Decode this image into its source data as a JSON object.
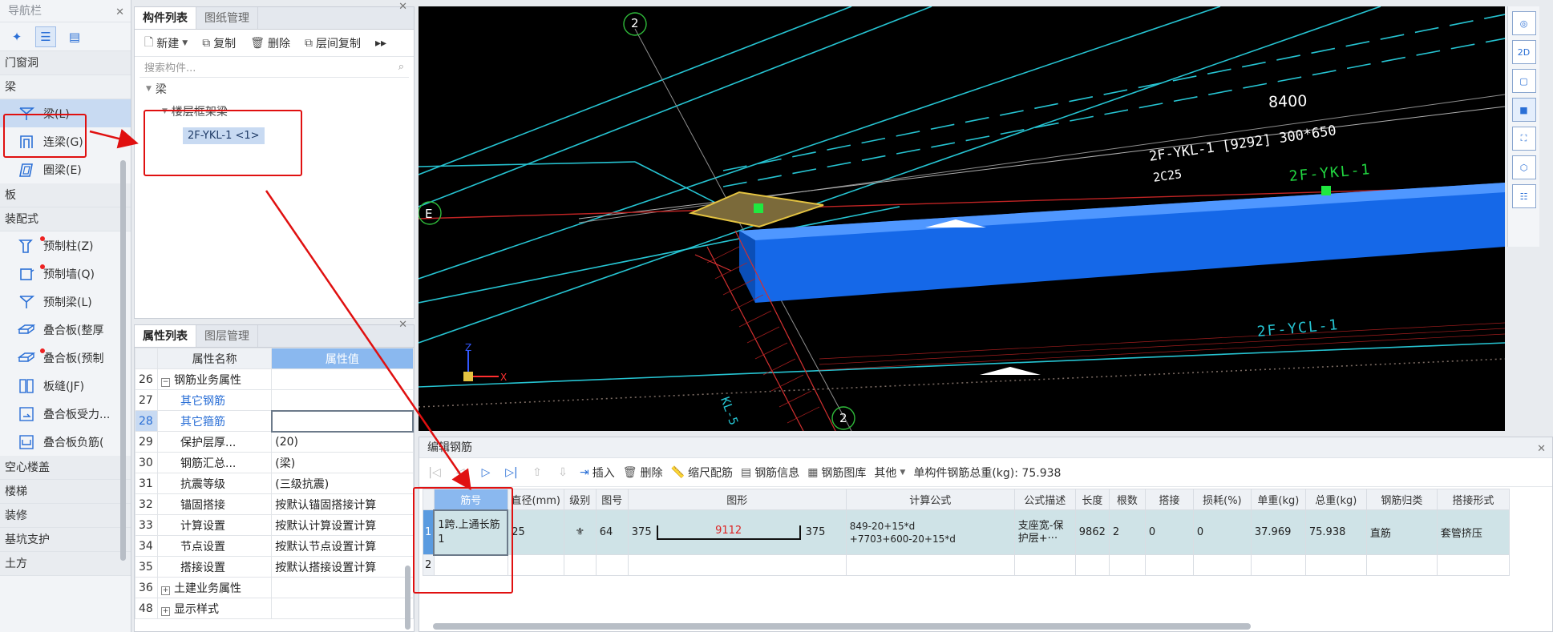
{
  "nav": {
    "title": "导航栏",
    "categories": {
      "door_window": "门窗洞",
      "beam_cat": "梁",
      "slab": "板",
      "prefab": "装配式",
      "hollow": "空心楼盖",
      "stairs": "楼梯",
      "decoration": "装修",
      "foundation_support": "基坑支护",
      "earthwork": "土方"
    },
    "beam_items": [
      "梁(L)",
      "连梁(G)",
      "圈梁(E)"
    ],
    "prefab_items": [
      "预制柱(Z)",
      "预制墙(Q)",
      "预制梁(L)",
      "叠合板(整厚",
      "叠合板(预制",
      "板缝(JF)",
      "叠合板受力...",
      "叠合板负筋("
    ]
  },
  "component_panel": {
    "tabs": [
      "构件列表",
      "图纸管理"
    ],
    "toolbar": [
      "新建",
      "复制",
      "删除",
      "层间复制"
    ],
    "search_placeholder": "搜索构件...",
    "tree_root": "梁",
    "tree_group": "楼层框架梁",
    "tree_item": "2F-YKL-1 <1>"
  },
  "property_panel": {
    "tabs": [
      "属性列表",
      "图层管理"
    ],
    "headers": [
      "属性名称",
      "属性值"
    ],
    "rows": [
      {
        "n": "26",
        "name": "钢筋业务属性",
        "value": "",
        "kind": "group"
      },
      {
        "n": "27",
        "name": "其它钢筋",
        "value": "",
        "kind": "link"
      },
      {
        "n": "28",
        "name": "其它箍筋",
        "value": "",
        "kind": "link-edit"
      },
      {
        "n": "29",
        "name": "保护层厚...",
        "value": "(20)",
        "kind": "normal"
      },
      {
        "n": "30",
        "name": "钢筋汇总...",
        "value": "(梁)",
        "kind": "normal"
      },
      {
        "n": "31",
        "name": "抗震等级",
        "value": "(三级抗震)",
        "kind": "normal"
      },
      {
        "n": "32",
        "name": "锚固搭接",
        "value": "按默认锚固搭接计算",
        "kind": "normal"
      },
      {
        "n": "33",
        "name": "计算设置",
        "value": "按默认计算设置计算",
        "kind": "normal"
      },
      {
        "n": "34",
        "name": "节点设置",
        "value": "按默认节点设置计算",
        "kind": "normal"
      },
      {
        "n": "35",
        "name": "搭接设置",
        "value": "按默认搭接设置计算",
        "kind": "normal"
      },
      {
        "n": "36",
        "name": "土建业务属性",
        "value": "",
        "kind": "group"
      },
      {
        "n": "48",
        "name": "显示样式",
        "value": "",
        "kind": "group"
      }
    ]
  },
  "viewport": {
    "axis_top": "2",
    "axis_bottom": "2",
    "axis_left": "E",
    "dimension": "8400",
    "beam_label": "2F-YKL-1 [9292] 300*650",
    "beam_sub": "2C25",
    "beam_tag": "2F-YKL-1",
    "beam_tag2": "2F-YCL-1",
    "vert_tag": "KL-5"
  },
  "rebar_panel": {
    "title": "编辑钢筋",
    "toolbar": [
      "插入",
      "删除",
      "缩尺配筋",
      "钢筋信息",
      "钢筋图库",
      "其他"
    ],
    "total_weight": "单构件钢筋总重(kg): 75.938",
    "headers": [
      "筋号",
      "直径(mm)",
      "级别",
      "图号",
      "图形",
      "计算公式",
      "公式描述",
      "长度",
      "根数",
      "搭接",
      "损耗(%)",
      "单重(kg)",
      "总重(kg)",
      "钢筋归类",
      "搭接形式"
    ],
    "row1": {
      "idx": "1",
      "bar_no": "1跨.上通长筋1",
      "diameter": "25",
      "grade": "⚜",
      "fig_no": "64",
      "shape_left": "375",
      "shape_mid": "9112",
      "shape_right": "375",
      "formula": "849-20+15*d+7703+600-20+15*d",
      "formula_l1": "849-20+15*d",
      "formula_l2": "+7703+600-20+15*d",
      "desc_l1": "支座宽-保",
      "desc_l2": "护层+···",
      "length": "9862",
      "count": "2",
      "lap": "0",
      "loss": "0",
      "unit_weight": "37.969",
      "total_weight": "75.938",
      "category": "直筋",
      "lap_type": "套管挤压"
    },
    "row2_idx": "2"
  }
}
